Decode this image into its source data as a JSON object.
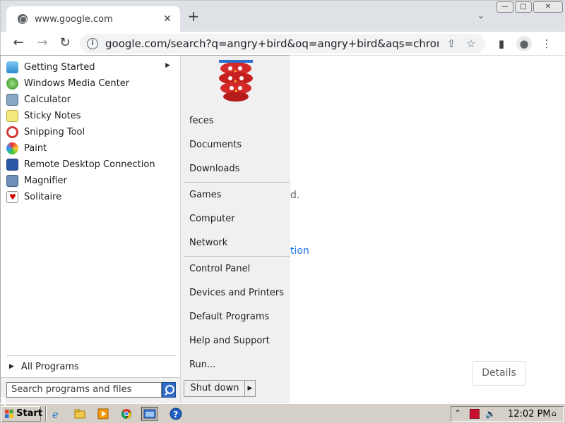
{
  "browser": {
    "tab_title": "www.google.com",
    "tab_close": "✕",
    "new_tab": "+",
    "tab_search": "⌄",
    "window_buttons": {
      "minimize": "—",
      "maximize": "▢",
      "close": "✕"
    },
    "nav": {
      "back": "←",
      "forward": "→",
      "reload": "↻"
    },
    "url": "google.com/search?q=angry+bird&oq=angry+bird&aqs=chrome..6...",
    "omnibox_icons": {
      "share": "⇪",
      "bookmark": "☆"
    },
    "toolbar_icons": {
      "side_panel": "▮",
      "profile": "●",
      "menu": "⋮"
    }
  },
  "page": {
    "fragment_1": "d.",
    "fragment_2": "tion",
    "details_button": "Details"
  },
  "start_menu": {
    "programs": [
      {
        "label": "Getting Started",
        "icon": "getting-started-icon",
        "has_submenu": true
      },
      {
        "label": "Windows Media Center",
        "icon": "media-center-icon"
      },
      {
        "label": "Calculator",
        "icon": "calculator-icon"
      },
      {
        "label": "Sticky Notes",
        "icon": "sticky-notes-icon"
      },
      {
        "label": "Snipping Tool",
        "icon": "snipping-tool-icon"
      },
      {
        "label": "Paint",
        "icon": "paint-icon"
      },
      {
        "label": "Remote Desktop Connection",
        "icon": "remote-desktop-icon"
      },
      {
        "label": "Magnifier",
        "icon": "magnifier-icon"
      },
      {
        "label": "Solitaire",
        "icon": "solitaire-icon"
      }
    ],
    "all_programs": "All Programs",
    "search_placeholder": "Search programs and files",
    "right_items": [
      {
        "label": "feces"
      },
      {
        "label": "Documents"
      },
      {
        "label": "Downloads"
      },
      {
        "label": "Games"
      },
      {
        "label": "Computer"
      },
      {
        "label": "Network"
      },
      {
        "label": "Control Panel"
      },
      {
        "label": "Devices and Printers"
      },
      {
        "label": "Default Programs"
      },
      {
        "label": "Help and Support"
      },
      {
        "label": "Run..."
      }
    ],
    "shutdown": "Shut down",
    "shutdown_arrow": "▶"
  },
  "taskbar": {
    "start": "Start",
    "clock": "12:02 PM",
    "quick_launch": [
      "ie-icon",
      "folder-icon",
      "media-player-icon",
      "chrome-icon",
      "window-icon",
      "help-icon"
    ]
  }
}
